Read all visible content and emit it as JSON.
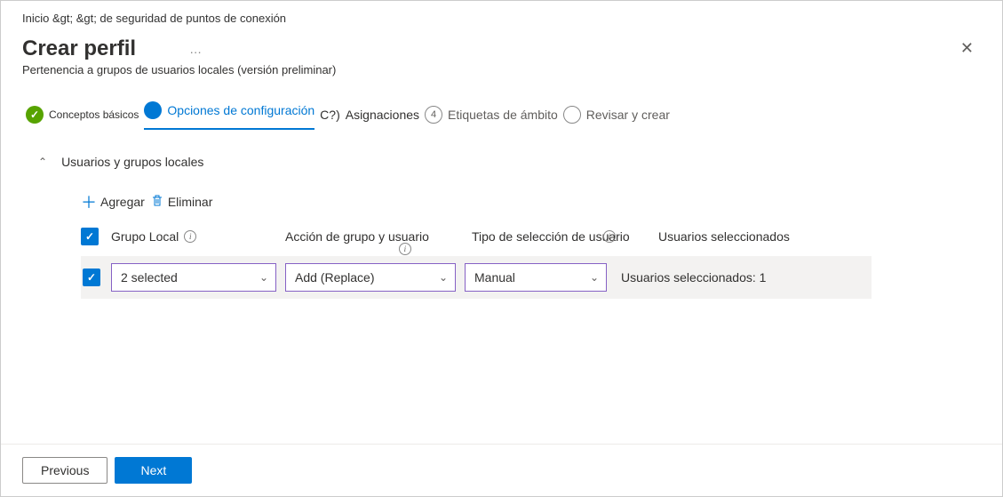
{
  "breadcrumb": "Inicio &gt;   &gt; de seguridad de puntos de conexión",
  "header": {
    "title": "Crear perfil",
    "subtitle": "Pertenencia a grupos de usuarios locales (versión preliminar)"
  },
  "stepper": {
    "step1": "Conceptos básicos",
    "step2": "Opciones de configuración",
    "step3_prefix": "C?)",
    "step3": "Asignaciones",
    "step4_num": "4",
    "step4": "Etiquetas de ámbito",
    "step5": "Revisar y crear"
  },
  "section": {
    "title": "Usuarios y grupos locales",
    "add": "Agregar",
    "delete": "Eliminar"
  },
  "columns": {
    "c1": "Grupo Local",
    "c2": "Acción de grupo y usuario",
    "c3": "Tipo de selección de usuario",
    "c4": "Usuarios seleccionados"
  },
  "row": {
    "local_group": "2 selected",
    "action": "Add (Replace)",
    "selection_type": "Manual",
    "selected_users": "Usuarios seleccionados: 1"
  },
  "footer": {
    "previous": "Previous",
    "next": "Next"
  }
}
